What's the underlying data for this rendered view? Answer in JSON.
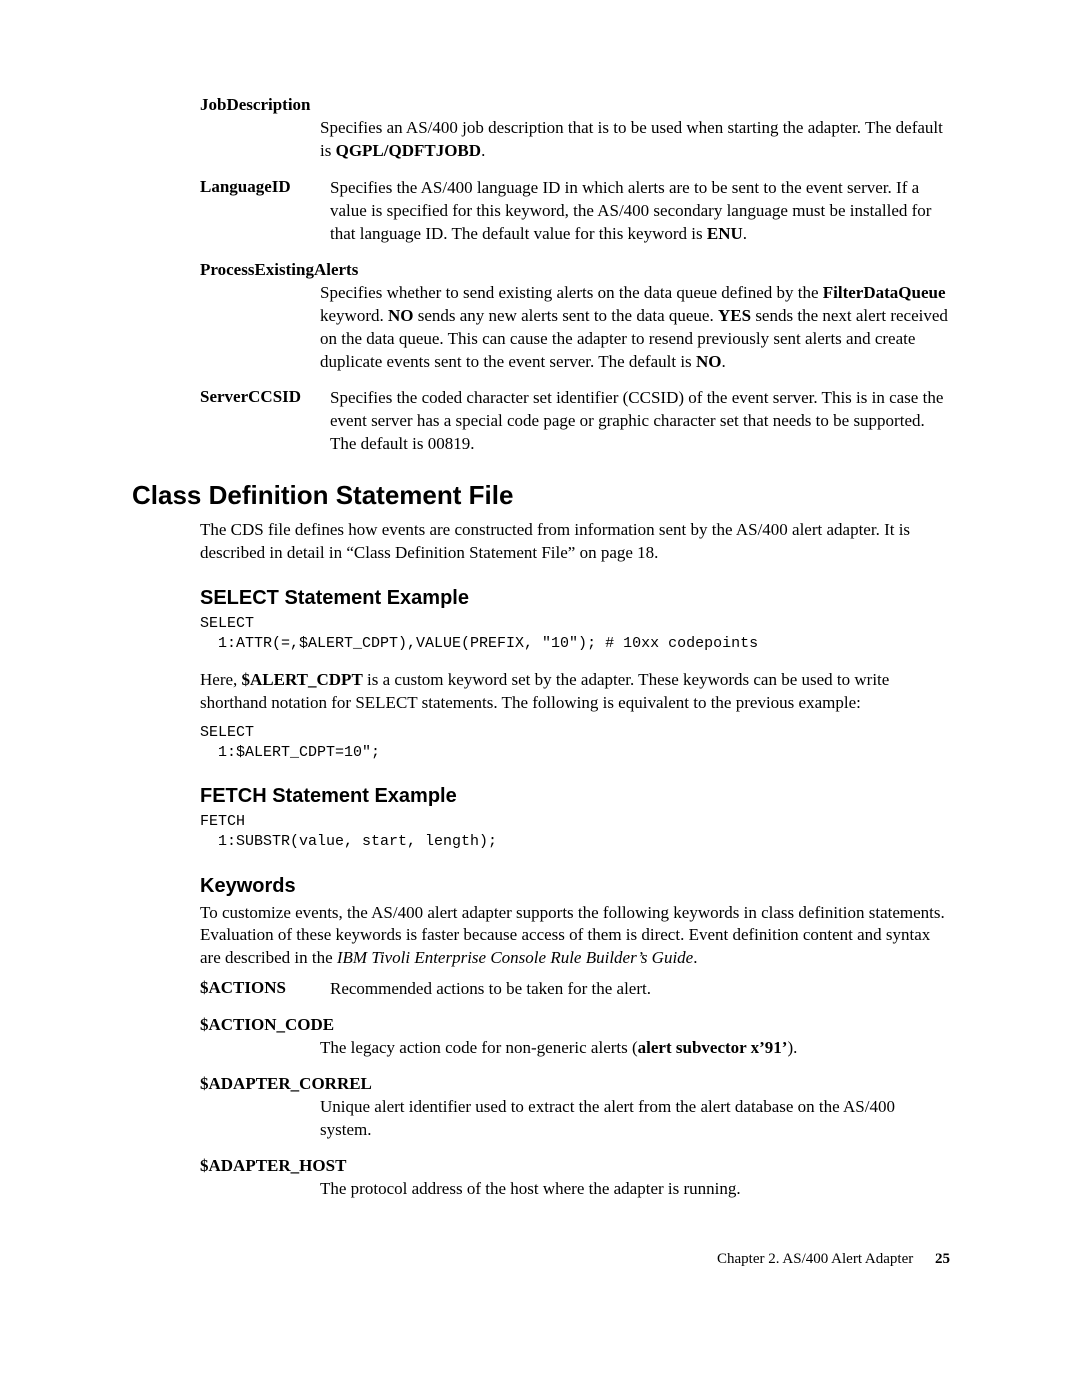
{
  "defs1": {
    "jobdesc": {
      "term": "JobDescription",
      "desc_parts": [
        "Specifies an AS/400 job description that is to be used when starting the adapter. The default is ",
        "QGPL/QDFTJOBD",
        "."
      ]
    },
    "langid": {
      "term": "LanguageID",
      "desc_parts": [
        "Specifies the AS/400 language ID in which alerts are to be sent to the event server. If a value is specified for this keyword, the AS/400 secondary language must be installed for that language ID. The default value for this keyword is ",
        "ENU",
        "."
      ]
    },
    "procexist": {
      "term": "ProcessExistingAlerts",
      "desc_parts": [
        "Specifies whether to send existing alerts on the data queue defined by the ",
        "FilterDataQueue",
        " keyword. ",
        "NO",
        " sends any new alerts sent to the data queue. ",
        "YES",
        " sends the next alert received on the data queue. This can cause the adapter to resend previously sent alerts and create duplicate events sent to the event server. The default is ",
        "NO",
        "."
      ]
    },
    "serverccsid": {
      "term": "ServerCCSID",
      "desc": "Specifies the coded character set identifier (CCSID) of the event server. This is in case the event server has a special code page or graphic character set that needs to be supported. The default is 00819."
    }
  },
  "h1": "Class Definition Statement File",
  "intro": "The CDS file defines how events are constructed from information sent by the AS/400 alert adapter. It is described in detail in “Class Definition Statement File” on page 18.",
  "select": {
    "heading": "SELECT Statement Example",
    "code1": "SELECT\n  1:ATTR(=,$ALERT_CDPT),VALUE(PREFIX, \"10\"); # 10xx codepoints",
    "para_parts": [
      "Here, ",
      "$ALERT_CDPT",
      " is a custom keyword set by the adapter. These keywords can be used to write shorthand notation for SELECT statements. The following is equivalent to the previous example:"
    ],
    "code2": "SELECT\n  1:$ALERT_CDPT=10\";"
  },
  "fetch": {
    "heading": "FETCH Statement Example",
    "code": "FETCH\n  1:SUBSTR(value, start, length);"
  },
  "keywords": {
    "heading": "Keywords",
    "intro_parts": [
      "To customize events, the AS/400 alert adapter supports the following keywords in class definition statements. Evaluation of these keywords is faster because access of them is direct. Event definition content and syntax are described in the ",
      "IBM Tivoli Enterprise Console Rule Builder’s Guide",
      "."
    ],
    "actions": {
      "term": "$ACTIONS",
      "desc": "Recommended actions to be taken for the alert."
    },
    "action_code": {
      "term": "$ACTION_CODE",
      "desc_parts": [
        "The legacy action code for non-generic alerts (",
        "alert subvector x’91’",
        ")."
      ]
    },
    "adapter_correl": {
      "term": "$ADAPTER_CORREL",
      "desc": "Unique alert identifier used to extract the alert from the alert database on the AS/400 system."
    },
    "adapter_host": {
      "term": "$ADAPTER_HOST",
      "desc": "The protocol address of the host where the adapter is running."
    }
  },
  "footer": {
    "chapter": "Chapter 2. AS/400 Alert Adapter",
    "page": "25"
  }
}
